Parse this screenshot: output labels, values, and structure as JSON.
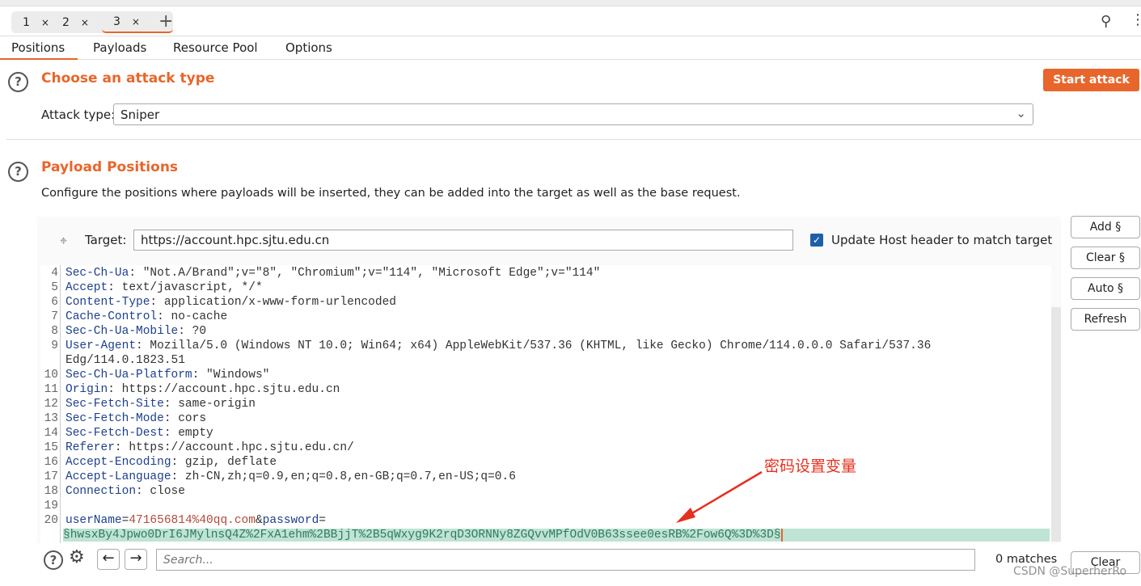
{
  "tabs": [
    {
      "label": "1",
      "close": "×"
    },
    {
      "label": "2",
      "close": "×"
    },
    {
      "label": "3",
      "close": "×"
    }
  ],
  "add_tab": "+",
  "subtabs": [
    "Positions",
    "Payloads",
    "Resource Pool",
    "Options"
  ],
  "attack": {
    "title": "Choose an attack type",
    "start": "Start attack",
    "label": "Attack type:",
    "value": "Sniper"
  },
  "positions": {
    "title": "Payload Positions",
    "desc": "Configure the positions where payloads will be inserted, they can be added into the target as well as the base request.",
    "target_label": "Target:",
    "target_value": "https://account.hpc.sjtu.edu.cn",
    "update_host": "Update Host header to match target",
    "update_host_checked": true
  },
  "side_buttons": [
    "Add §",
    "Clear §",
    "Auto §",
    "Refresh"
  ],
  "request": [
    {
      "n": "4",
      "h": "Sec-Ch-Ua",
      "v": " \"Not.A/Brand\";v=\"8\", \"Chromium\";v=\"114\", \"Microsoft Edge\";v=\"114\""
    },
    {
      "n": "5",
      "h": "Accept",
      "v": " text/javascript, */*"
    },
    {
      "n": "6",
      "h": "Content-Type",
      "v": " application/x-www-form-urlencoded"
    },
    {
      "n": "7",
      "h": "Cache-Control",
      "v": " no-cache"
    },
    {
      "n": "8",
      "h": "Sec-Ch-Ua-Mobile",
      "v": " ?0"
    },
    {
      "n": "9",
      "h": "User-Agent",
      "v": " Mozilla/5.0 (Windows NT 10.0; Win64; x64) AppleWebKit/537.36 (KHTML, like Gecko) Chrome/114.0.0.0 Safari/537.36"
    },
    {
      "n": "",
      "h": "",
      "v": "Edg/114.0.1823.51"
    },
    {
      "n": "10",
      "h": "Sec-Ch-Ua-Platform",
      "v": " \"Windows\""
    },
    {
      "n": "11",
      "h": "Origin",
      "v": " https://account.hpc.sjtu.edu.cn"
    },
    {
      "n": "12",
      "h": "Sec-Fetch-Site",
      "v": " same-origin"
    },
    {
      "n": "13",
      "h": "Sec-Fetch-Mode",
      "v": " cors"
    },
    {
      "n": "14",
      "h": "Sec-Fetch-Dest",
      "v": " empty"
    },
    {
      "n": "15",
      "h": "Referer",
      "v": " https://account.hpc.sjtu.edu.cn/"
    },
    {
      "n": "16",
      "h": "Accept-Encoding",
      "v": " gzip, deflate"
    },
    {
      "n": "17",
      "h": "Accept-Language",
      "v": " zh-CN,zh;q=0.9,en;q=0.8,en-GB;q=0.7,en-US;q=0.6"
    },
    {
      "n": "18",
      "h": "Connection",
      "v": " close"
    },
    {
      "n": "19",
      "h": "",
      "v": ""
    }
  ],
  "body": {
    "n": "20",
    "k1": "userName",
    "e1": "=",
    "v1": "471656814%40qq.com",
    "amp": "&",
    "k2": "password",
    "e2": "=",
    "payload": "§hwsxBy4Jpwo0DrI6JMylnsQ4Z%2FxA1ehm%2BBjjT%2B5qWxyg9K2rqD3ORNNy8ZGQvvMPfOdV0B63ssee0esRB%2Fow6Q%3D%3D§"
  },
  "annotation": "密码设置变量",
  "search": {
    "placeholder": "Search...",
    "matches": "0 matches",
    "clear": "Clear"
  },
  "watermark": "CSDN @SuperherRo",
  "colors": {
    "accent": "#e8662b",
    "payload_bg": "#bfe3d5",
    "checkbox": "#1f5fa8"
  }
}
